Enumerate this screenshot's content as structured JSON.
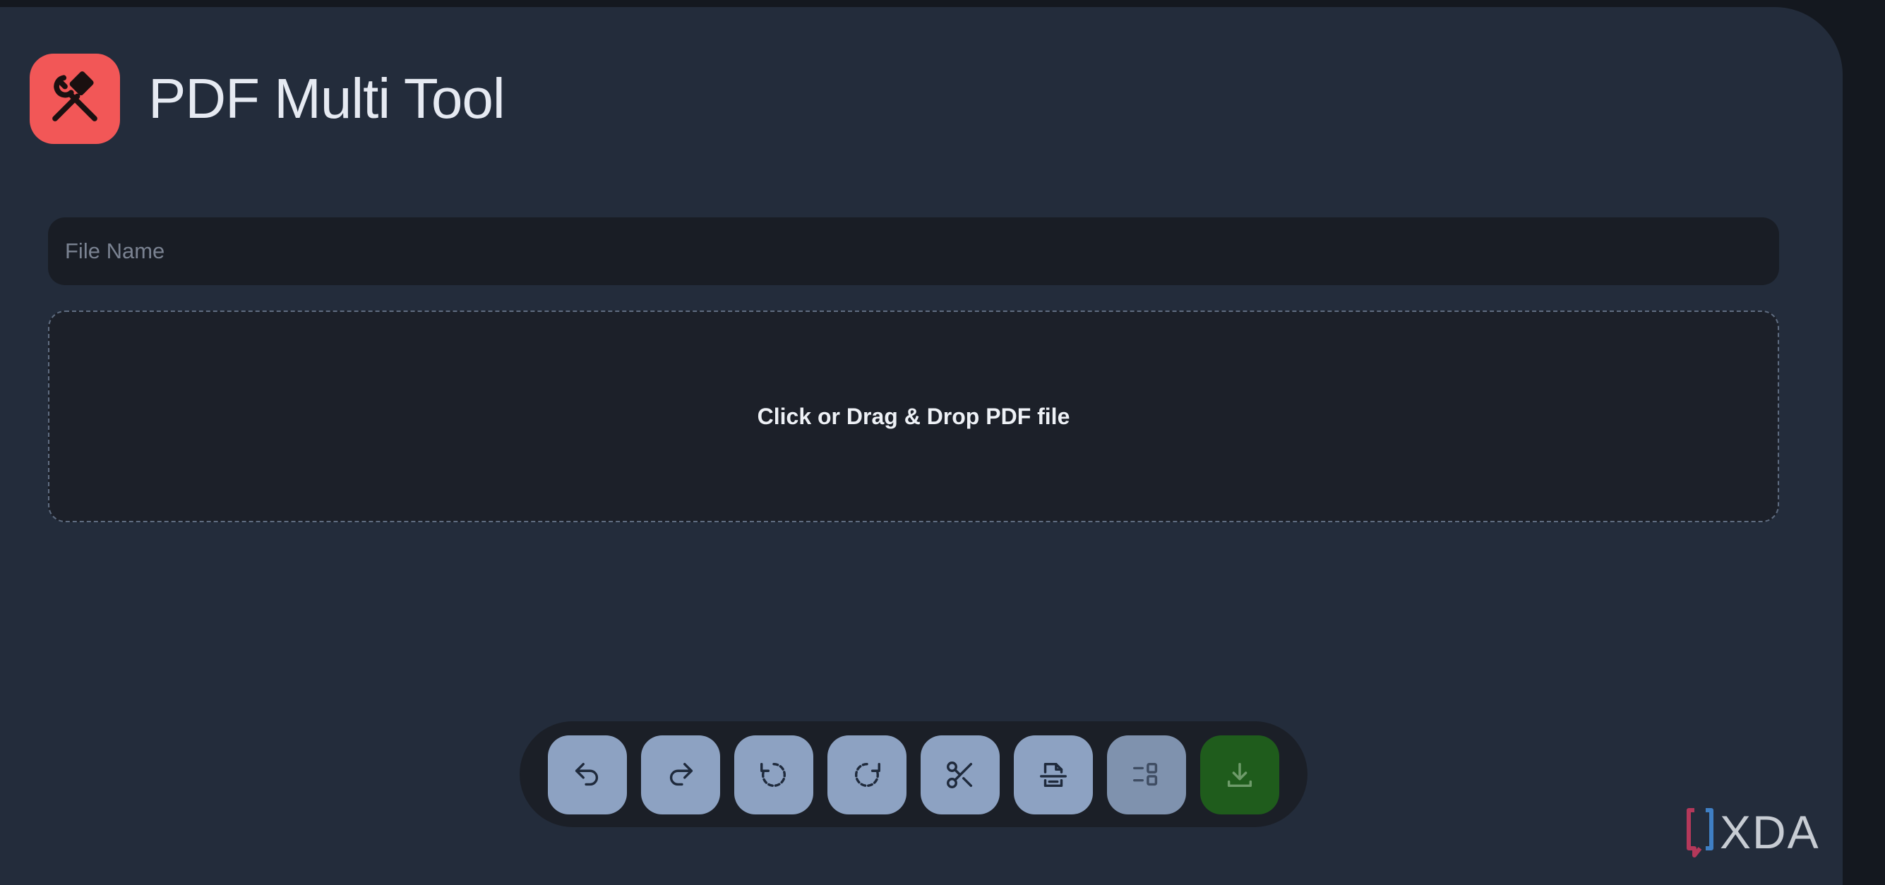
{
  "app": {
    "title": "PDF Multi Tool",
    "icon": "hammer-wrench-icon",
    "accent_color": "#f25757"
  },
  "file_name_input": {
    "placeholder": "File Name",
    "value": ""
  },
  "dropzone": {
    "label": "Click or Drag & Drop PDF file"
  },
  "toolbar": {
    "buttons": [
      {
        "name": "undo",
        "icon": "undo-icon"
      },
      {
        "name": "redo",
        "icon": "redo-icon"
      },
      {
        "name": "rotate-left",
        "icon": "rotate-ccw-icon"
      },
      {
        "name": "rotate-right",
        "icon": "rotate-cw-icon"
      },
      {
        "name": "split",
        "icon": "scissors-icon"
      },
      {
        "name": "remove-pages",
        "icon": "file-remove-icon"
      },
      {
        "name": "select-pages",
        "icon": "layout-list-icon"
      },
      {
        "name": "download",
        "icon": "download-icon",
        "color": "#1f5c1c"
      }
    ]
  },
  "watermark": {
    "text": "XDA"
  },
  "colors": {
    "background": "#232c3b",
    "input_background": "#191d25",
    "button": "#8da2c2",
    "download_button": "#1f5c1c"
  }
}
